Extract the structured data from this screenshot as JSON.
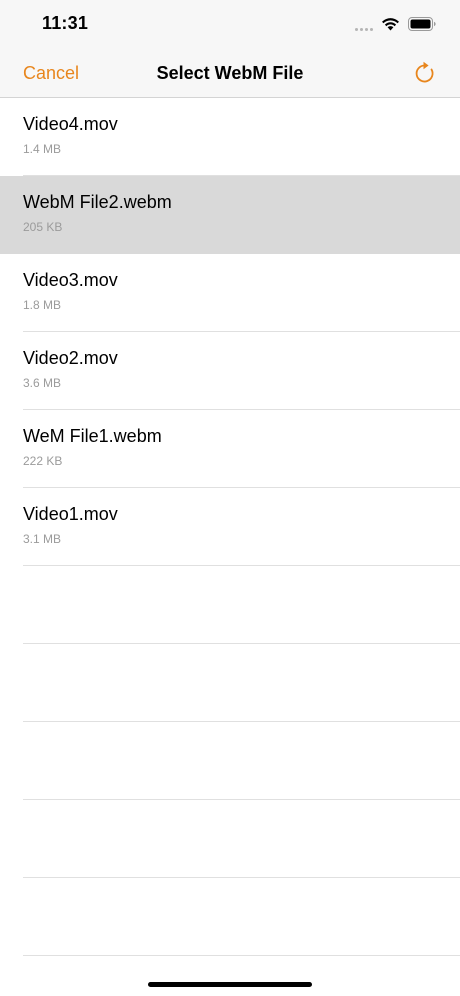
{
  "status_bar": {
    "time": "11:31"
  },
  "nav": {
    "cancel_label": "Cancel",
    "title": "Select WebM File",
    "refresh_icon": "refresh-icon"
  },
  "colors": {
    "accent": "#e8861d",
    "selected_row": "#d9d9d9",
    "secondary_text": "#9b9b9b"
  },
  "files": [
    {
      "name": "Video4.mov",
      "size": "1.4 MB",
      "selected": false
    },
    {
      "name": "WebM File2.webm",
      "size": "205 KB",
      "selected": true
    },
    {
      "name": "Video3.mov",
      "size": "1.8 MB",
      "selected": false
    },
    {
      "name": "Video2.mov",
      "size": "3.6 MB",
      "selected": false
    },
    {
      "name": "WeM File1.webm",
      "size": "222 KB",
      "selected": false
    },
    {
      "name": "Video1.mov",
      "size": "3.1 MB",
      "selected": false
    }
  ]
}
